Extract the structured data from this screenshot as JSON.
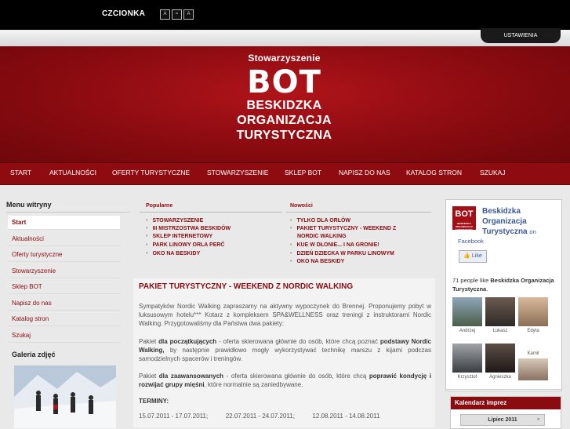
{
  "topbar": {
    "font_label": "CZCIONKA",
    "font_buttons": [
      "A",
      "=",
      "A"
    ],
    "settings_label": "USTAWIENIA"
  },
  "header": {
    "line1": "Stowarzyszenie",
    "line2": "BOT",
    "line3": "BESKIDZKA",
    "line4": "ORGANIZACJA",
    "line5": "TURYSTYCZNA"
  },
  "nav": {
    "items": [
      "START",
      "AKTUALNOŚCI",
      "OFERTY TURYSTYCZNE",
      "STOWARZYSZENIE",
      "SKLEP BOT",
      "NAPISZ DO NAS",
      "KATALOG STRON",
      "SZUKAJ"
    ]
  },
  "sidebar": {
    "title": "Menu witryny",
    "items": [
      "Start",
      "Aktualności",
      "Oferty turystyczne",
      "Stowarzyszenie",
      "Sklep BOT",
      "Napisz do nas",
      "Katalog stron",
      "Szukaj"
    ],
    "gallery_title": "Galeria zdjęć"
  },
  "popular": {
    "title": "Popularne",
    "items": [
      "STOWARZYSZENIE",
      "III MISTRZOSTWA BESKIDÓW",
      "SKLEP INTERNETOWY",
      "PARK LINOWY ORLA PERĆ",
      "OKO NA BESKIDY"
    ]
  },
  "news": {
    "title": "Nowości",
    "items": [
      "TYLKO DLA ORŁÓW",
      "PAKIET TURYSTYCZNY - WEEKEND Z",
      "NORDIC WALKING",
      "KUE W DŁONIE... I NA GRONIE!",
      "DZIEŃ DZIECKA W PARKU LINOWYM",
      "OKO NA BESKIDY"
    ]
  },
  "article": {
    "title": "PAKIET TURYSTYCZNY - WEEKEND Z NORDIC WALKING",
    "p1": "Sympatyków Nordic Walking zapraszamy na aktywny wypoczynek do Brennej. Proponujemy pobyt w luksusowym hotelu*** Kotarz z kompleksem SPA&WELLNESS oraz treningi z instruktorami Nordic Walking. Przygotowaliśmy dla Państwa dwa pakiety:",
    "p2_a": "Pakiet ",
    "p2_b": "dla początkujących",
    "p2_c": " - oferta skierowana głównie do osób, które chcą poznać ",
    "p2_d": "podstawy Nordic Walking,",
    "p2_e": " by następnie prawidłowo mogły wykorzystywać technikę marszu z kijami podczas samodzielnych spacerów i treningów.",
    "p3_a": "Pakiet ",
    "p3_b": "dla zaawansowanych",
    "p3_c": " - oferta skierowana głównie do osób, które chcą ",
    "p3_d": "poprawić kondycję i rozwijać grupy mięśni",
    "p3_e": ", które normalnie są zaniedbywane.",
    "terms_label": "TERMINY:",
    "terms": [
      "15.07.2011 - 17.07.2011;",
      "22.07.2011 - 24.07.2011;",
      "12.08.2011 - 14.08.2011"
    ]
  },
  "facebook": {
    "logo_text": "BOT",
    "logo_small": "BESKIDZKA ORGANIZACJA TURYSTYCZNA",
    "page_name": "Beskidzka Organizacja Turystyczna",
    "on_text": "on",
    "facebook_label": "Facebook",
    "like_label": "Like",
    "count_prefix": "71 people like ",
    "count_name": "Beskidzka Organizacja Turystyczna",
    "count_suffix": ".",
    "fans": [
      "Andrzej",
      "Łukasz",
      "Edyta",
      "Krzysztof",
      "Agnieszka",
      "Kamil"
    ]
  },
  "calendar": {
    "title": "Kalendarz imprez",
    "month": "Lipiec 2011",
    "prev": "«",
    "next": "»"
  },
  "colors": {
    "brand_red": "#8a0b10",
    "link_red": "#8a0b10",
    "facebook_blue": "#3b5998"
  }
}
